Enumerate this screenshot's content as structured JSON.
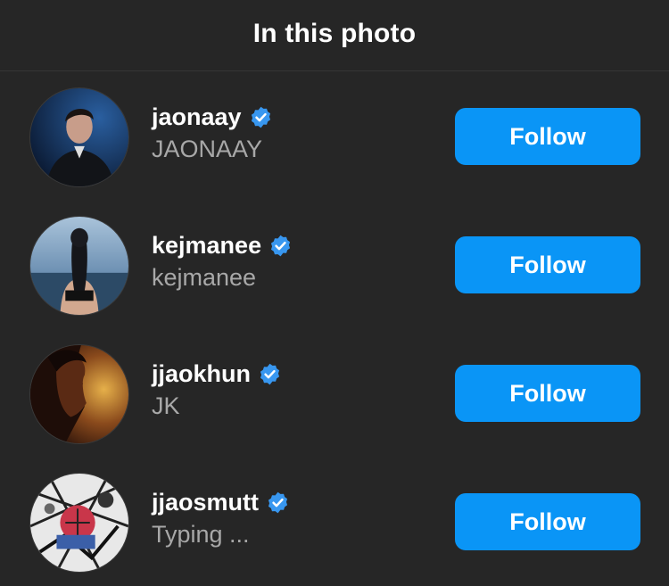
{
  "header": {
    "title": "In this photo"
  },
  "colors": {
    "background": "#262626",
    "follow_button": "#0a95f6",
    "verified_badge": "#3897f0",
    "secondary_text": "#a8a8a8"
  },
  "people": [
    {
      "username": "jaonaay",
      "full_name": "JAONAAY",
      "verified": true,
      "follow_label": "Follow",
      "avatar": "portrait-man-dark-blue"
    },
    {
      "username": "kejmanee",
      "full_name": "kejmanee",
      "verified": true,
      "follow_label": "Follow",
      "avatar": "woman-back-sea"
    },
    {
      "username": "jjaokhun",
      "full_name": "JK",
      "verified": true,
      "follow_label": "Follow",
      "avatar": "profile-warm-light"
    },
    {
      "username": "jjaosmutt",
      "full_name": "Typing ...",
      "verified": true,
      "follow_label": "Follow",
      "avatar": "comic-illustration"
    }
  ]
}
